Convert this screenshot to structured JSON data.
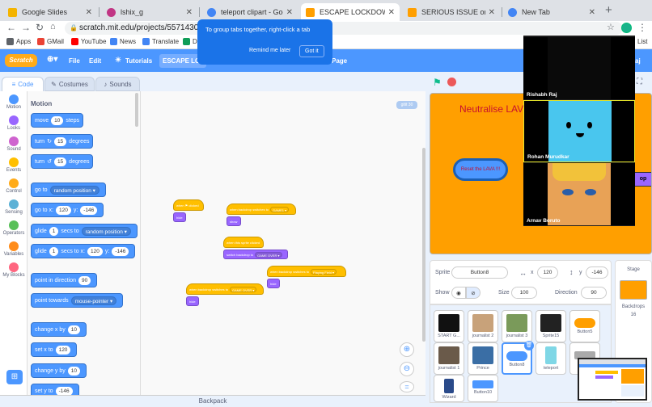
{
  "browser": {
    "tabs": [
      {
        "label": "Google Slides",
        "icon": "slides-icon",
        "color": "#f4b400"
      },
      {
        "label": "lshix_g",
        "icon": "ig-icon",
        "color": "#c13584"
      },
      {
        "label": "teleport clipart - Google S",
        "icon": "google-icon",
        "color": "#4285f4"
      },
      {
        "label": "ESCAPE LOCKDOWN on Sc",
        "icon": "scratch-icon",
        "color": "#ff9f00"
      },
      {
        "label": "SERIOUS ISSUE on Scratch",
        "icon": "scratch-icon",
        "color": "#ff9f00"
      },
      {
        "label": "New Tab",
        "icon": "chrome-icon",
        "color": "#4285f4"
      }
    ],
    "url": "scratch.mit.edu/projects/557143071/edi",
    "bookmarks": [
      "Apps",
      "GMail",
      "YouTube",
      "News",
      "Translate",
      "D"
    ],
    "bookmarks_right": "List",
    "new_tab": "+"
  },
  "tooltip": {
    "text": "To group tabs together, right-click a tab",
    "remind": "Remind me later",
    "got_it": "Got it"
  },
  "scratch_menu": {
    "logo": "Scratch",
    "file": "File",
    "edit": "Edit",
    "tutorials": "Tutorials",
    "project_title": "ESCAPE LOCK",
    "see_project": "Page",
    "user": "aj"
  },
  "editor_tabs": {
    "code": "Code",
    "costumes": "Costumes",
    "sounds": "Sounds"
  },
  "categories": [
    {
      "label": "Motion",
      "color": "#4c97ff"
    },
    {
      "label": "Looks",
      "color": "#9966ff"
    },
    {
      "label": "Sound",
      "color": "#cf63cf"
    },
    {
      "label": "Events",
      "color": "#ffbf00"
    },
    {
      "label": "Control",
      "color": "#ffab19"
    },
    {
      "label": "Sensing",
      "color": "#5cb1d6"
    },
    {
      "label": "Operators",
      "color": "#59c059"
    },
    {
      "label": "Variables",
      "color": "#ff8c1a"
    },
    {
      "label": "My Blocks",
      "color": "#ff6680"
    }
  ],
  "palette": {
    "heading": "Motion",
    "move": {
      "pre": "move",
      "val": "10",
      "post": "steps"
    },
    "turn_cw": {
      "pre": "turn",
      "icon": "↻",
      "val": "15",
      "post": "degrees"
    },
    "turn_ccw": {
      "pre": "turn",
      "icon": "↺",
      "val": "15",
      "post": "degrees"
    },
    "goto": {
      "pre": "go to",
      "dd": "random position ▾"
    },
    "goto_xy": {
      "pre": "go to x:",
      "x": "120",
      "mid": "y:",
      "y": "-146"
    },
    "glide": {
      "pre": "glide",
      "val": "1",
      "mid": "secs to",
      "dd": "random position ▾"
    },
    "glide_xy": {
      "pre": "glide",
      "val": "1",
      "mid": "secs to x:",
      "x": "120",
      "mid2": "y:",
      "y": "-146"
    },
    "point_dir": {
      "pre": "point in direction",
      "val": "90"
    },
    "point_towards": {
      "pre": "point towards",
      "dd": "mouse-pointer ▾"
    },
    "change_x": {
      "pre": "change x by",
      "val": "10"
    },
    "set_x": {
      "pre": "set x to",
      "val": "120"
    },
    "change_y": {
      "pre": "change y by",
      "val": "10"
    },
    "set_y": {
      "pre": "set y to",
      "val": "-146"
    }
  },
  "scripts": {
    "zoom_badge": "gitit 30",
    "s1_hat": "when ⚑ clicked",
    "s1_block": "hide",
    "s2_hat": "when backdrop switches to",
    "s2_val": "GAME1 ▾",
    "s2_block": "show",
    "s3_hat": "when this sprite clicked",
    "s3_block": "switch backdrop to",
    "s3_val": "GAME OVER ▾",
    "s4_hat": "when backdrop switches to",
    "s4_val": "Playing Field ▾",
    "s4_block": "hide",
    "s5_hat": "when backdrop switches to",
    "s5_val": "GAME OVER ▾",
    "s5_block": "hide"
  },
  "stage": {
    "title": "Neutralise LAV",
    "button": "Reset the LAVA !!!",
    "right_label": "op"
  },
  "sprite_info": {
    "sprite_label": "Sprite",
    "sprite_name": "Button8",
    "x_label": "x",
    "x": "120",
    "y_label": "y",
    "y": "-146",
    "show_label": "Show",
    "size_label": "Size",
    "size": "100",
    "direction_label": "Direction",
    "direction": "90"
  },
  "sprites": [
    {
      "name": "START G...",
      "color": "#111111"
    },
    {
      "name": "journalist 2",
      "color": "#c8a27a"
    },
    {
      "name": "journalist 3",
      "color": "#7a9a5a"
    },
    {
      "name": "Sprite15",
      "color": "#222222"
    },
    {
      "name": "Button5",
      "color": "#ff9f00"
    },
    {
      "name": "journalist 1",
      "color": "#6a5a4a"
    },
    {
      "name": "Prince",
      "color": "#3a6ea5"
    },
    {
      "name": "Button8",
      "color": "#4c97ff"
    },
    {
      "name": "teleport",
      "color": "#7fd7e6"
    },
    {
      "name": "",
      "color": "#aaaaaa"
    },
    {
      "name": "Wizard",
      "color": "#2a4a8a"
    },
    {
      "name": "Button10",
      "color": "#4c97ff"
    }
  ],
  "stage_panel": {
    "label": "Stage",
    "backdrops_label": "Backdrops",
    "backdrops": "16"
  },
  "backpack": "Backpack",
  "video": [
    {
      "name": "Rishabh Raj"
    },
    {
      "name": "Rohan Murudkar"
    },
    {
      "name": "Arnav Boruto"
    }
  ]
}
